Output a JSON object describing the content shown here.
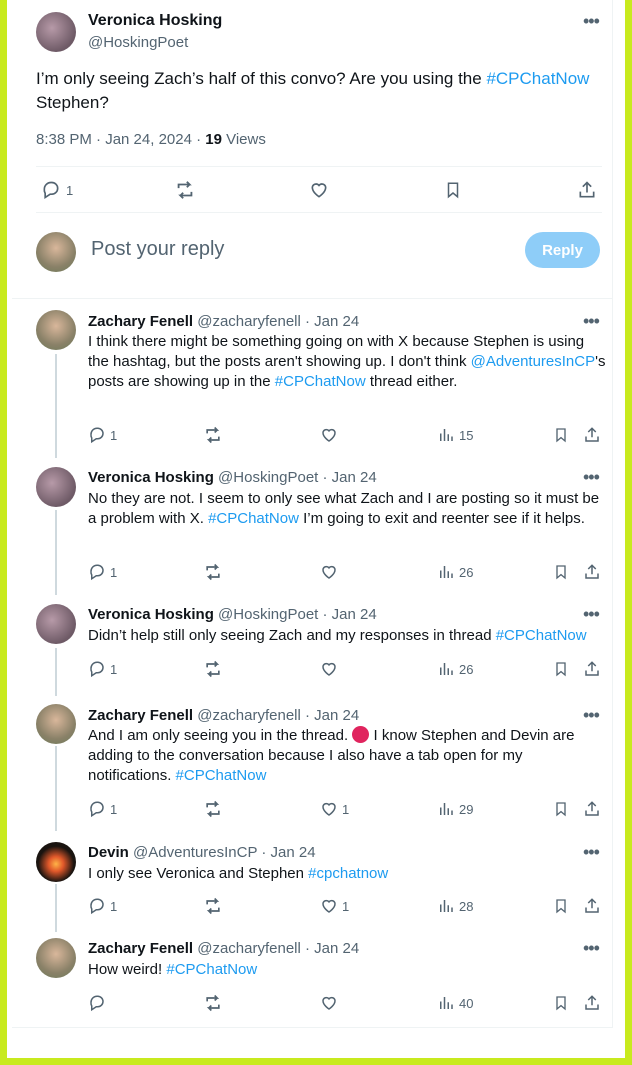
{
  "main_tweet": {
    "name": "Veronica Hosking",
    "handle": "@HoskingPoet",
    "text_before": "I’m only seeing Zach’s half of this convo? Are you using the ",
    "hashtag": "#CPChatNow",
    "text_after": " Stephen?",
    "time": "8:38 PM · Jan 24, 2024 · ",
    "views_count": "19",
    "views_label": " Views",
    "reply_count": "1"
  },
  "composer": {
    "placeholder": "Post your reply",
    "reply_button": "Reply"
  },
  "replies": [
    {
      "name": "Zachary Fenell",
      "handle": "@zacharyfenell · Jan 24",
      "t1": "I think there might be something going on with X because Stephen is using the hashtag, but the posts aren't showing up. I don't think ",
      "mention": "@AdventuresInCP",
      "t2": "'s posts are showing up in the ",
      "hashtag": "#CPChatNow",
      "t3": " thread either.",
      "replies": "1",
      "likes": "",
      "views": "15"
    },
    {
      "name": "Veronica Hosking",
      "handle": "@HoskingPoet · Jan 24",
      "t1": "No they are not. I seem to only see what Zach and I are posting so it must be a problem with X. ",
      "hashtag": "#CPChatNow",
      "t2": " I’m going to exit and reenter see if it helps.",
      "replies": "1",
      "likes": "",
      "views": "26"
    },
    {
      "name": "Veronica Hosking",
      "handle": "@HoskingPoet · Jan 24",
      "t1": "Didn’t help still only seeing Zach and my responses in thread ",
      "hashtag": "#CPChatNow",
      "replies": "1",
      "likes": "",
      "views": "26"
    },
    {
      "name": "Zachary Fenell",
      "handle": "@zacharyfenell · Jan 24",
      "t1": "And I am only seeing you in the thread. ",
      "t2": " I know Stephen and Devin are adding to the conversation because I also have a tab open for my notifications. ",
      "hashtag": "#CPChatNow",
      "replies": "1",
      "likes": "1",
      "views": "29"
    },
    {
      "name": "Devin",
      "handle": "@AdventuresInCP · Jan 24",
      "t1": "I only see Veronica and Stephen ",
      "hashtag": "#cpchatnow",
      "replies": "1",
      "likes": "1",
      "views": "28"
    },
    {
      "name": "Zachary Fenell",
      "handle": "@zacharyfenell · Jan 24",
      "t1": "How weird! ",
      "hashtag": "#CPChatNow",
      "replies": "",
      "likes": "",
      "views": "40"
    }
  ],
  "icons": {
    "reply": "speech-bubble-icon",
    "repost": "repost-icon",
    "like": "heart-icon",
    "views": "bar-chart-icon",
    "bookmark": "bookmark-icon",
    "share": "share-icon",
    "more": "more-dots-icon"
  },
  "colors": {
    "accent": "#1d9bf0",
    "reply_button": "#8ecdf8",
    "border": "#c8ea1e"
  }
}
